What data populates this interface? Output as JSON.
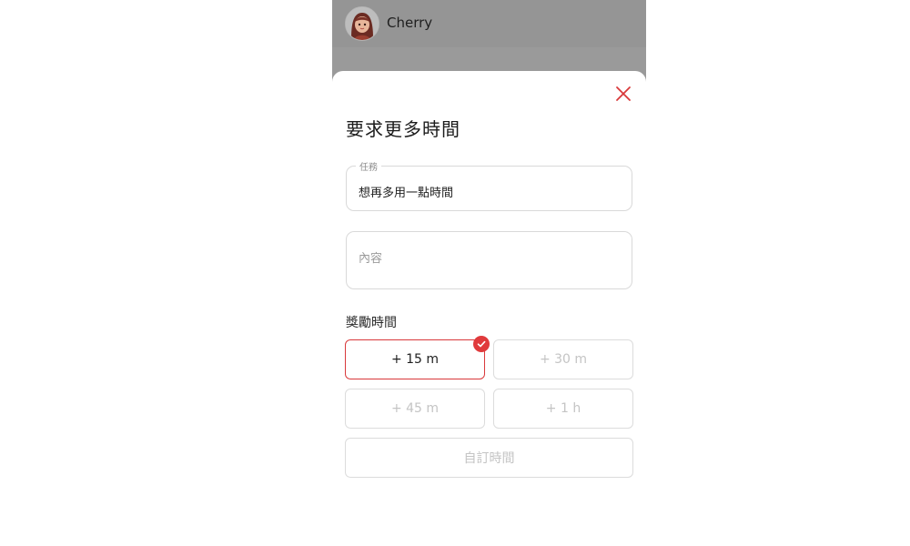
{
  "header": {
    "username": "Cherry",
    "avatar_icon": "avatar-girl-icon"
  },
  "dialog": {
    "title": "要求更多時間",
    "close_icon": "close-icon",
    "task_field": {
      "label": "任務",
      "value": "想再多用一點時間"
    },
    "content_field": {
      "placeholder": "內容"
    },
    "reward_label": "獎勵時間",
    "options": [
      {
        "label": "+ 15 m",
        "selected": true
      },
      {
        "label": "+ 30 m",
        "selected": false
      },
      {
        "label": "+ 45 m",
        "selected": false
      },
      {
        "label": "+ 1 h",
        "selected": false
      },
      {
        "label": "自訂時間",
        "selected": false
      }
    ],
    "selected_check_icon": "checkmark-icon"
  },
  "colors": {
    "accent": "#d9393b",
    "overlay": "#959595"
  }
}
